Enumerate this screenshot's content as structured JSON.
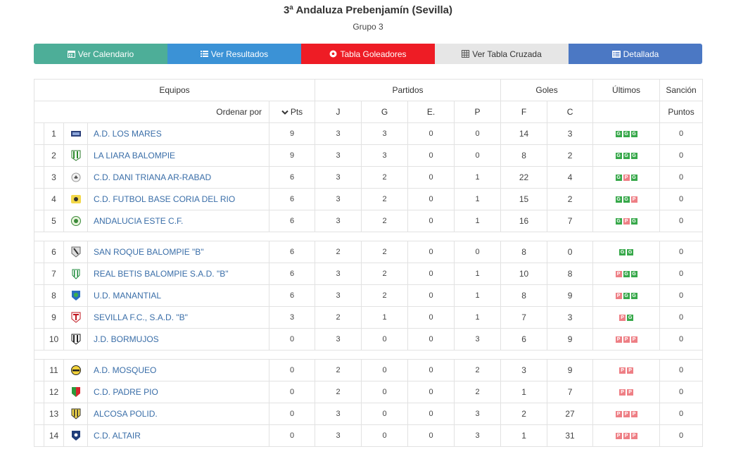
{
  "header": {
    "title": "3ª Andaluza Prebenjamín (Sevilla)",
    "subtitle": "Grupo 3"
  },
  "buttons": [
    {
      "label": "Ver Calendario",
      "icon": "calendar-icon"
    },
    {
      "label": "Ver Resultados",
      "icon": "list-icon"
    },
    {
      "label": "Tabla Goleadores",
      "icon": "soccer-ball-icon"
    },
    {
      "label": "Ver Tabla Cruzada",
      "icon": "table-icon"
    },
    {
      "label": "Detallada",
      "icon": "detail-list-icon"
    }
  ],
  "colors": {
    "calendario": "#4dae98",
    "resultados": "#3b92d6",
    "goleadores": "#ee1c25",
    "cruzada": "#e6e6e6",
    "detallada": "#4b78c4",
    "win": "#37a84a",
    "loss": "#ee7f85",
    "link": "#3a6ea8"
  },
  "table": {
    "groups": {
      "equipos": "Equipos",
      "partidos": "Partidos",
      "goles": "Goles",
      "ultimos": "Últimos",
      "sancion": "Sanción"
    },
    "ordenar": "Ordenar por",
    "pts": "Pts",
    "cols": {
      "j": "J",
      "g": "G",
      "e": "E.",
      "p": "P",
      "f": "F",
      "c": "C",
      "puntos": "Puntos"
    },
    "rows": [
      {
        "pos": "1",
        "team": "A.D. LOS MARES",
        "crest": "flag-crest",
        "pts": "9",
        "j": "3",
        "g": "3",
        "e": "0",
        "p": "0",
        "f": "14",
        "c": "3",
        "last": [
          "G",
          "G",
          "G"
        ],
        "sancion": "0"
      },
      {
        "pos": "2",
        "team": "LA LIARA BALOMPIE",
        "crest": "green-stripes-crest",
        "pts": "9",
        "j": "3",
        "g": "3",
        "e": "0",
        "p": "0",
        "f": "8",
        "c": "2",
        "last": [
          "G",
          "G",
          "G"
        ],
        "sancion": "0"
      },
      {
        "pos": "3",
        "team": "C.D. DANI TRIANA AR-RABAD",
        "crest": "bird-crest",
        "pts": "6",
        "j": "3",
        "g": "2",
        "e": "0",
        "p": "1",
        "f": "22",
        "c": "4",
        "last": [
          "G",
          "P",
          "G"
        ],
        "sancion": "0"
      },
      {
        "pos": "4",
        "team": "C.D. FUTBOL BASE CORIA DEL RIO",
        "crest": "yellow-crest",
        "pts": "6",
        "j": "3",
        "g": "2",
        "e": "0",
        "p": "1",
        "f": "15",
        "c": "2",
        "last": [
          "G",
          "G",
          "P"
        ],
        "sancion": "0"
      },
      {
        "pos": "5",
        "team": "ANDALUCIA ESTE C.F.",
        "crest": "green-round-crest",
        "pts": "6",
        "j": "3",
        "g": "2",
        "e": "0",
        "p": "1",
        "f": "16",
        "c": "7",
        "last": [
          "G",
          "P",
          "G"
        ],
        "sancion": "0"
      },
      {
        "pos": "6",
        "team": "SAN ROQUE BALOMPIE \"B\"",
        "crest": "grey-shield-crest",
        "pts": "6",
        "j": "2",
        "g": "2",
        "e": "0",
        "p": "0",
        "f": "8",
        "c": "0",
        "last": [
          "G",
          "G"
        ],
        "sancion": "0"
      },
      {
        "pos": "7",
        "team": "REAL BETIS BALOMPIE S.A.D. \"B\"",
        "crest": "betis-crest",
        "pts": "6",
        "j": "3",
        "g": "2",
        "e": "0",
        "p": "1",
        "f": "10",
        "c": "8",
        "last": [
          "P",
          "G",
          "G"
        ],
        "sancion": "0"
      },
      {
        "pos": "8",
        "team": "U.D. MANANTIAL",
        "crest": "blue-green-crest",
        "pts": "6",
        "j": "3",
        "g": "2",
        "e": "0",
        "p": "1",
        "f": "8",
        "c": "9",
        "last": [
          "P",
          "G",
          "G"
        ],
        "sancion": "0"
      },
      {
        "pos": "9",
        "team": "SEVILLA F.C., S.A.D. \"B\"",
        "crest": "sevilla-crest",
        "pts": "3",
        "j": "2",
        "g": "1",
        "e": "0",
        "p": "1",
        "f": "7",
        "c": "3",
        "last": [
          "P",
          "G"
        ],
        "sancion": "0"
      },
      {
        "pos": "10",
        "team": "J.D. BORMUJOS",
        "crest": "black-white-crest",
        "pts": "0",
        "j": "3",
        "g": "0",
        "e": "0",
        "p": "3",
        "f": "6",
        "c": "9",
        "last": [
          "P",
          "P",
          "P"
        ],
        "sancion": "0"
      },
      {
        "pos": "11",
        "team": "A.D. MOSQUEO",
        "crest": "yellow-black-crest",
        "pts": "0",
        "j": "2",
        "g": "0",
        "e": "0",
        "p": "2",
        "f": "3",
        "c": "9",
        "last": [
          "P",
          "P"
        ],
        "sancion": "0"
      },
      {
        "pos": "12",
        "team": "C.D. PADRE PIO",
        "crest": "red-green-crest",
        "pts": "0",
        "j": "2",
        "g": "0",
        "e": "0",
        "p": "2",
        "f": "1",
        "c": "7",
        "last": [
          "P",
          "P"
        ],
        "sancion": "0"
      },
      {
        "pos": "13",
        "team": "ALCOSA POLID.",
        "crest": "yellow-stripes-crest",
        "pts": "0",
        "j": "3",
        "g": "0",
        "e": "0",
        "p": "3",
        "f": "2",
        "c": "27",
        "last": [
          "P",
          "P",
          "P"
        ],
        "sancion": "0"
      },
      {
        "pos": "14",
        "team": "C.D. ALTAIR",
        "crest": "navy-shield-crest",
        "pts": "0",
        "j": "3",
        "g": "0",
        "e": "0",
        "p": "3",
        "f": "1",
        "c": "31",
        "last": [
          "P",
          "P",
          "P"
        ],
        "sancion": "0"
      }
    ]
  }
}
